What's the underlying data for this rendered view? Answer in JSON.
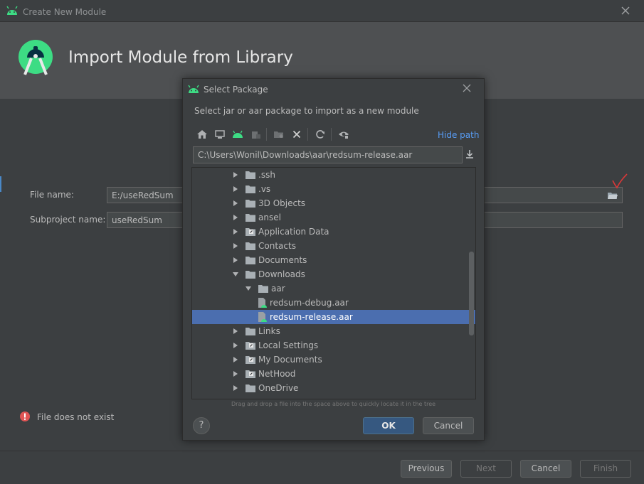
{
  "window": {
    "title": "Create New Module",
    "header_title": "Import Module from Library"
  },
  "form": {
    "file_name_label": "File name:",
    "file_name_value": "E:/useRedSum",
    "subproject_label": "Subproject name:",
    "subproject_value": "useRedSum"
  },
  "error": {
    "message": "File does not exist"
  },
  "footer": {
    "previous": "Previous",
    "next": "Next",
    "cancel": "Cancel",
    "finish": "Finish"
  },
  "select_package": {
    "title": "Select Package",
    "description": "Select jar or aar package to import as a new module",
    "hide_path": "Hide path",
    "path": "C:\\Users\\Wonil\\Downloads\\aar\\redsum-release.aar",
    "hint": "Drag and drop a file into the space above to quickly locate it in the tree",
    "ok": "OK",
    "cancel": "Cancel",
    "help": "?",
    "tree": [
      {
        "label": ".ssh",
        "level": 0,
        "expanded": false,
        "type": "folder"
      },
      {
        "label": ".vs",
        "level": 0,
        "expanded": false,
        "type": "folder"
      },
      {
        "label": "3D Objects",
        "level": 0,
        "expanded": false,
        "type": "folder"
      },
      {
        "label": "ansel",
        "level": 0,
        "expanded": false,
        "type": "folder"
      },
      {
        "label": "Application Data",
        "level": 0,
        "expanded": false,
        "type": "link-folder"
      },
      {
        "label": "Contacts",
        "level": 0,
        "expanded": false,
        "type": "folder"
      },
      {
        "label": "Documents",
        "level": 0,
        "expanded": false,
        "type": "folder"
      },
      {
        "label": "Downloads",
        "level": 0,
        "expanded": true,
        "type": "folder"
      },
      {
        "label": "aar",
        "level": 1,
        "expanded": true,
        "type": "folder"
      },
      {
        "label": "redsum-debug.aar",
        "level": 2,
        "type": "aar"
      },
      {
        "label": "redsum-release.aar",
        "level": 2,
        "type": "aar",
        "selected": true
      },
      {
        "label": "Links",
        "level": 0,
        "expanded": false,
        "type": "folder"
      },
      {
        "label": "Local Settings",
        "level": 0,
        "expanded": false,
        "type": "link-folder"
      },
      {
        "label": "My Documents",
        "level": 0,
        "expanded": false,
        "type": "link-folder"
      },
      {
        "label": "NetHood",
        "level": 0,
        "expanded": false,
        "type": "link-folder"
      },
      {
        "label": "OneDrive",
        "level": 0,
        "expanded": false,
        "type": "folder"
      }
    ],
    "toolbar_icons": [
      "home-icon",
      "desktop-icon",
      "android-project-icon",
      "module-icon",
      "new-folder-icon",
      "delete-icon",
      "refresh-icon",
      "show-hidden-icon"
    ]
  },
  "colors": {
    "accent": "#589df6",
    "selection": "#4b6eaf",
    "android_green": "#3ddc84",
    "error_red": "#e05555"
  }
}
